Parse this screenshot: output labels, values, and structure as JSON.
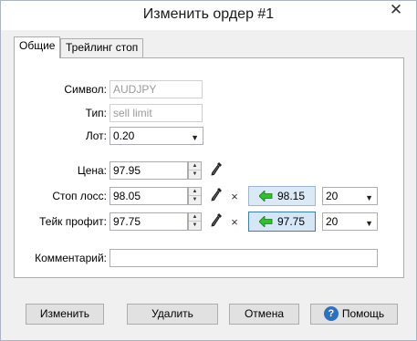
{
  "window": {
    "title": "Изменить ордер #1",
    "close_glyph": "✕"
  },
  "tabs": [
    {
      "label": "Общие",
      "active": true
    },
    {
      "label": "Трейлинг стоп",
      "active": false
    }
  ],
  "form": {
    "symbol_label": "Символ:",
    "symbol_value": "AUDJPY",
    "type_label": "Тип:",
    "type_value": "sell limit",
    "lot_label": "Лот:",
    "lot_value": "0.20",
    "price_label": "Цена:",
    "price_value": "97.95",
    "stoploss_label": "Стоп лосс:",
    "stoploss_value": "98.05",
    "stoploss_current": "98.15",
    "stoploss_points": "20",
    "takeprofit_label": "Тейк профит:",
    "takeprofit_value": "97.75",
    "takeprofit_current": "97.75",
    "takeprofit_points": "20",
    "comment_label": "Комментарий:",
    "comment_value": ""
  },
  "buttons": {
    "modify": "Изменить",
    "delete": "Удалить",
    "cancel": "Отмена",
    "help": "Помощь"
  },
  "colors": {
    "accent_arrow": "#2cc22c",
    "help_icon": "#2d6fc3"
  }
}
